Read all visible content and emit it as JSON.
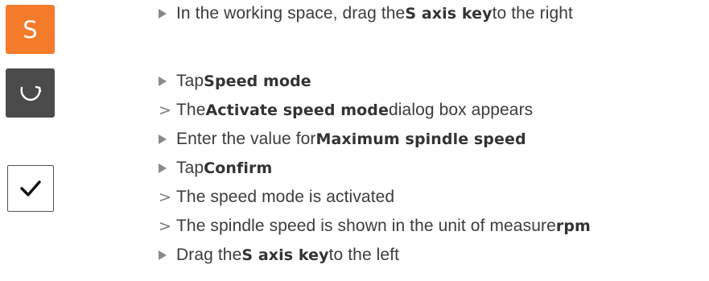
{
  "icons": {
    "s_axis_key_label": "S",
    "speed_mode": "rotate-arrow-icon",
    "confirm": "checkmark-icon"
  },
  "colors": {
    "s_key_bg": "#f47b2a",
    "speed_key_bg": "#4b4b4b",
    "text": "#3c3c3c",
    "marker": "#8a8a8a"
  },
  "steps": [
    {
      "type": "action",
      "before": "In the working space, drag the ",
      "bold": "S axis key",
      "after": " to the right"
    },
    {
      "type": "action",
      "before": "Tap ",
      "bold": "Speed mode",
      "after": ""
    },
    {
      "type": "result",
      "before": "The ",
      "bold": "Activate speed mode",
      "after": " dialog box appears"
    },
    {
      "type": "action",
      "before": "Enter the value for ",
      "bold": "Maximum spindle speed",
      "after": ""
    },
    {
      "type": "action",
      "before": "Tap ",
      "bold": "Confirm",
      "after": ""
    },
    {
      "type": "result",
      "before": "The speed mode is activated",
      "bold": "",
      "after": ""
    },
    {
      "type": "result",
      "before": "The spindle speed is shown in the unit of measure ",
      "bold": "rpm",
      "after": ""
    },
    {
      "type": "action",
      "before": "Drag the ",
      "bold": "S axis key",
      "after": " to the left"
    }
  ]
}
